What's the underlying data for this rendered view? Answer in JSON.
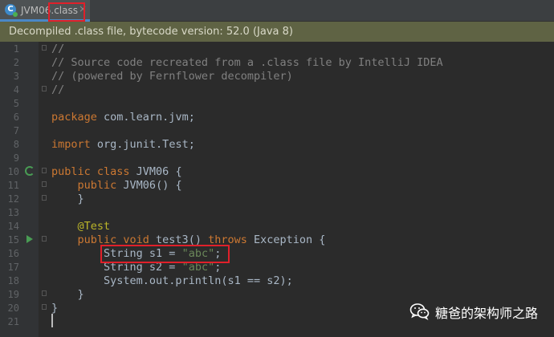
{
  "tab": {
    "icon_letter": "C",
    "name": "JVM06",
    "extension": ".class",
    "close_glyph": "×"
  },
  "banner": {
    "text": "Decompiled .class file, bytecode version: 52.0 (Java 8)"
  },
  "editor": {
    "line_numbers": [
      "1",
      "2",
      "3",
      "4",
      "5",
      "6",
      "7",
      "8",
      "9",
      "10",
      "11",
      "12",
      "13",
      "14",
      "15",
      "16",
      "17",
      "18",
      "19",
      "20",
      "21"
    ],
    "lines": {
      "l1": "//",
      "l2": "// Source code recreated from a .class file by IntelliJ IDEA",
      "l3": "// (powered by Fernflower decompiler)",
      "l4": "//",
      "l5": "",
      "l6_kw": "package",
      "l6_rest": " com.learn.jvm;",
      "l7": "",
      "l8_kw": "import",
      "l8_rest": " org.junit.Test;",
      "l9": "",
      "l10_kw": "public class",
      "l10_rest": " JVM06 {",
      "l11_indent": "    ",
      "l11_kw": "public",
      "l11_rest": " JVM06() {",
      "l12": "    }",
      "l13": "",
      "l14_indent": "    ",
      "l14_ann": "@Test",
      "l15_indent": "    ",
      "l15_kw1": "public void",
      "l15_mid": " test3() ",
      "l15_kw2": "throws",
      "l15_rest": " Exception {",
      "l16_code": "        String s1 = ",
      "l16_str": "\"abc\"",
      "l16_end": ";",
      "l17_code": "        String s2 = ",
      "l17_str": "\"abc\"",
      "l17_end": ";",
      "l18": "        System.out.println(s1 == s2);",
      "l19": "    }",
      "l20": "}",
      "l21": ""
    }
  },
  "watermark": {
    "text": "糖爸的架构师之路"
  },
  "colors": {
    "keyword": "#cc7832",
    "comment": "#808080",
    "string": "#6a8759",
    "annotation": "#bbb529",
    "highlight_box": "#e0202a",
    "banner_bg": "#5f6344"
  },
  "icons": {
    "tab_icon": "java-class-icon",
    "gutter_line10": "run-class-icon",
    "gutter_line15": "run-test-icon",
    "watermark": "wechat-icon"
  }
}
